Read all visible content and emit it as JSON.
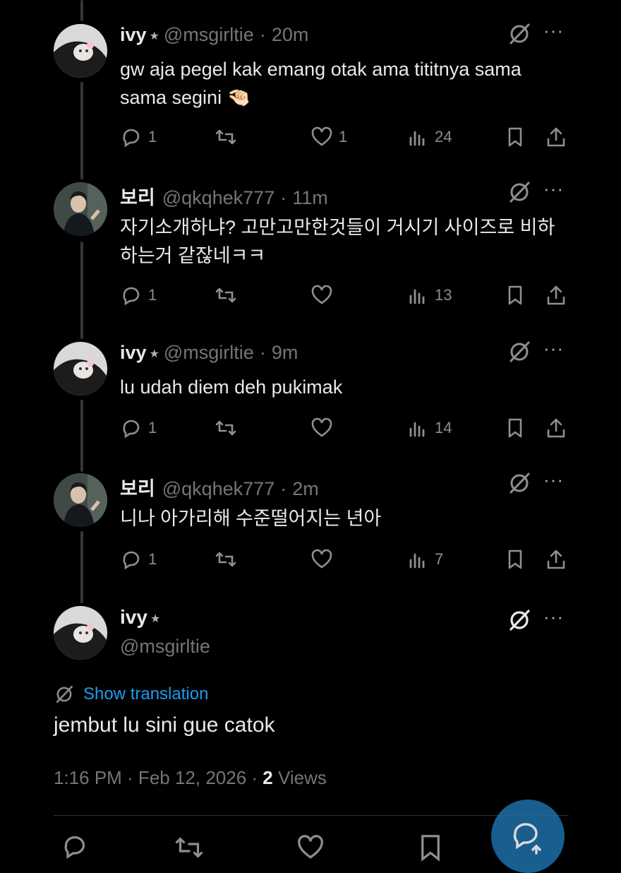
{
  "replies": [
    {
      "name": "ivy",
      "star": "★",
      "handle": "@msgirltie",
      "time": "20m",
      "text": "gw aja pegel kak emang otak ama tititnya sama sama segini 🤏🏻",
      "replies_count": "1",
      "likes": "1",
      "views": "24",
      "avatar": "ivy"
    },
    {
      "name": "보리",
      "star": "",
      "handle": "@qkqhek777",
      "time": "11m",
      "text": "자기소개하냐? 고만고만한것들이 거시기 사이즈로 비하 하는거 같잖네ㅋㅋ",
      "replies_count": "1",
      "likes": "",
      "views": "13",
      "avatar": "bori"
    },
    {
      "name": "ivy",
      "star": "★",
      "handle": "@msgirltie",
      "time": "9m",
      "text": "lu udah diem deh pukimak",
      "replies_count": "1",
      "likes": "",
      "views": "14",
      "avatar": "ivy"
    },
    {
      "name": "보리",
      "star": "",
      "handle": "@qkqhek777",
      "time": "2m",
      "text": "니나 아가리해 수준떨어지는 년아",
      "replies_count": "1",
      "likes": "",
      "views": "7",
      "avatar": "bori"
    }
  ],
  "main_tweet": {
    "name": "ivy",
    "star": "★",
    "handle": "@msgirltie",
    "show_translation": "Show translation",
    "text": "jembut lu sini gue catok",
    "timestamp": "1:16 PM · Feb 12, 2026 · ",
    "views_count": "2",
    "views_label": " Views"
  },
  "icons": [
    "reply-icon",
    "retweet-icon",
    "like-icon",
    "views-icon",
    "bookmark-icon",
    "share-icon",
    "grok-icon",
    "more-icon",
    "compose-reply-icon"
  ],
  "colors": {
    "accent": "#1d9bf0",
    "text": "#e7e9ea",
    "muted": "#71767b",
    "background": "#000000"
  }
}
